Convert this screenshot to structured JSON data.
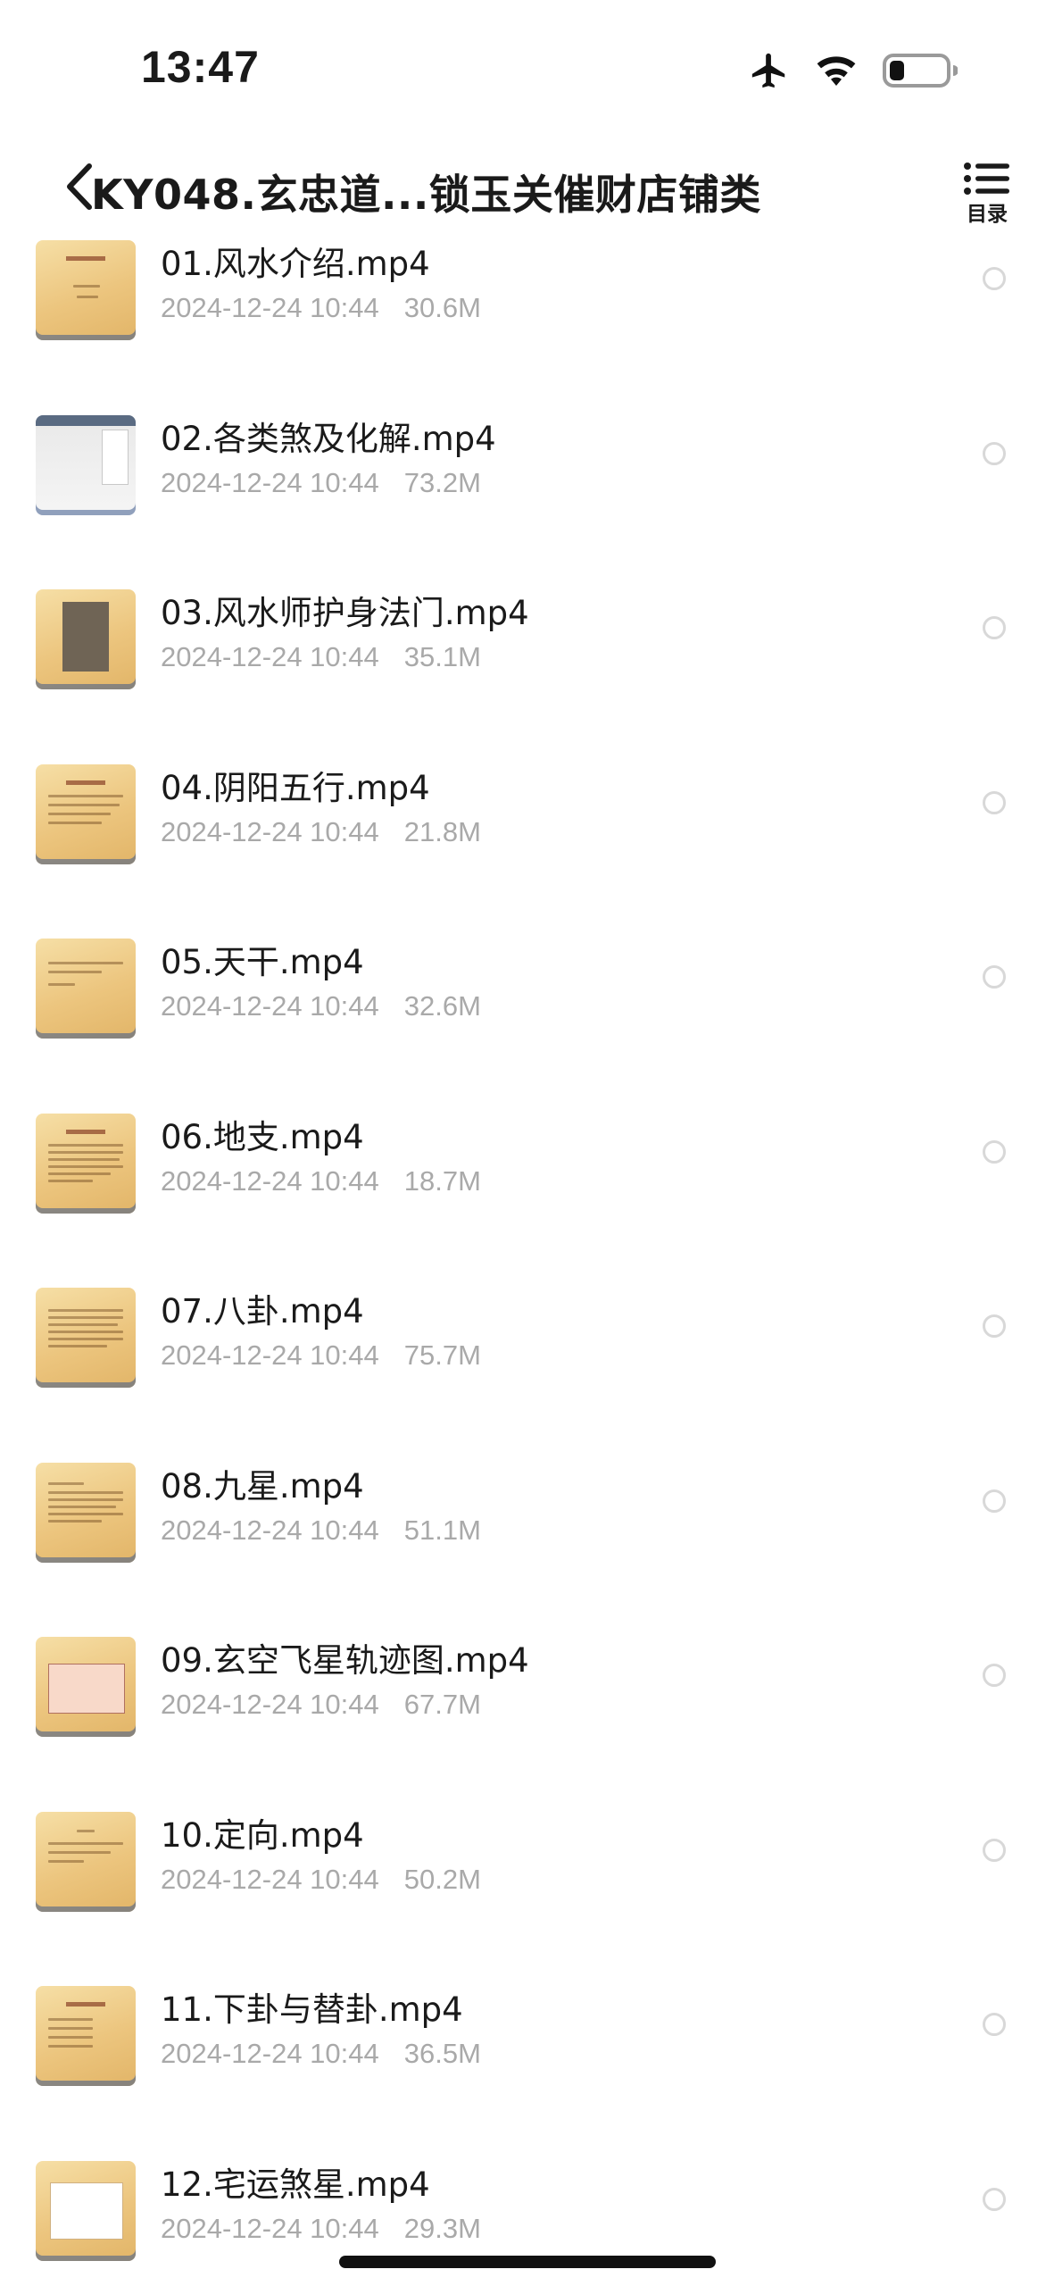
{
  "status_bar": {
    "time": "13:47",
    "icons": [
      "airplane-icon",
      "wifi-icon",
      "battery-icon"
    ]
  },
  "header": {
    "title": "KY048.玄忠道...锁玉关催财店铺类",
    "toc_label": "目录"
  },
  "files": [
    {
      "name": "01.风水介绍.mp4",
      "date": "2024-12-24 10:44",
      "size": "30.6M"
    },
    {
      "name": "02.各类煞及化解.mp4",
      "date": "2024-12-24 10:44",
      "size": "73.2M"
    },
    {
      "name": "03.风水师护身法门.mp4",
      "date": "2024-12-24 10:44",
      "size": "35.1M"
    },
    {
      "name": "04.阴阳五行.mp4",
      "date": "2024-12-24 10:44",
      "size": "21.8M"
    },
    {
      "name": "05.天干.mp4",
      "date": "2024-12-24 10:44",
      "size": "32.6M"
    },
    {
      "name": "06.地支.mp4",
      "date": "2024-12-24 10:44",
      "size": "18.7M"
    },
    {
      "name": "07.八卦.mp4",
      "date": "2024-12-24 10:44",
      "size": "75.7M"
    },
    {
      "name": "08.九星.mp4",
      "date": "2024-12-24 10:44",
      "size": "51.1M"
    },
    {
      "name": "09.玄空飞星轨迹图.mp4",
      "date": "2024-12-24 10:44",
      "size": "67.7M"
    },
    {
      "name": "10.定向.mp4",
      "date": "2024-12-24 10:44",
      "size": "50.2M"
    },
    {
      "name": "11.下卦与替卦.mp4",
      "date": "2024-12-24 10:44",
      "size": "36.5M"
    },
    {
      "name": "12.宅运煞星.mp4",
      "date": "2024-12-24 10:44",
      "size": "29.3M"
    }
  ]
}
